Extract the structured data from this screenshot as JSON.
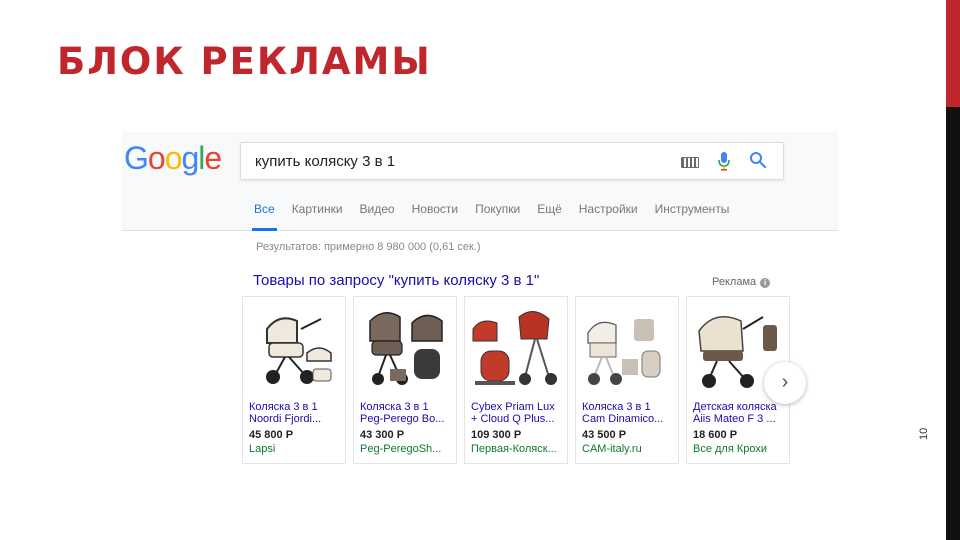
{
  "slide": {
    "title": "БЛОК РЕКЛАМЫ",
    "page_number": "10"
  },
  "google": {
    "logo_letters": [
      {
        "char": "G",
        "color": "#4285F4"
      },
      {
        "char": "o",
        "color": "#EA4335"
      },
      {
        "char": "o",
        "color": "#FBBC05"
      },
      {
        "char": "g",
        "color": "#4285F4"
      },
      {
        "char": "l",
        "color": "#34A853"
      },
      {
        "char": "e",
        "color": "#EA4335"
      }
    ],
    "search": {
      "value": "купить коляску 3 в 1"
    },
    "tabs": [
      "Все",
      "Картинки",
      "Видео",
      "Новости",
      "Покупки",
      "Ещё",
      "Настройки",
      "Инструменты"
    ],
    "active_tab": "Все",
    "result_stats": "Результатов: примерно 8 980 000 (0,61 сек.)",
    "ads_heading": "Товары по запросу \"купить коляску 3 в 1\"",
    "ad_label": "Реклама",
    "products": [
      {
        "title_line1": "Коляска 3 в 1",
        "title_line2": "Noordi Fjordi...",
        "price": "45 800 Р",
        "store": "Lapsi"
      },
      {
        "title_line1": "Коляска 3 в 1",
        "title_line2": "Peg-Perego Bo...",
        "price": "43 300 Р",
        "store": "Peg-PeregoSh..."
      },
      {
        "title_line1": "Cybex Priam Lux",
        "title_line2": "+ Cloud Q Plus...",
        "price": "109 300 Р",
        "store": "Первая-Коляск..."
      },
      {
        "title_line1": "Коляска 3 в 1",
        "title_line2": "Cam Dinamico...",
        "price": "43 500 Р",
        "store": "CAM-italy.ru"
      },
      {
        "title_line1": "Детская коляска",
        "title_line2": "Aiis Mateo F 3 ...",
        "price": "18 600 Р",
        "store": "Все для Крохи"
      }
    ],
    "next_icon": "chevron-right-icon"
  },
  "colors": {
    "accent": "#c0272d",
    "link": "#1a0dab",
    "tab_active": "#1a73e8",
    "store_green": "#0d7a2a"
  }
}
